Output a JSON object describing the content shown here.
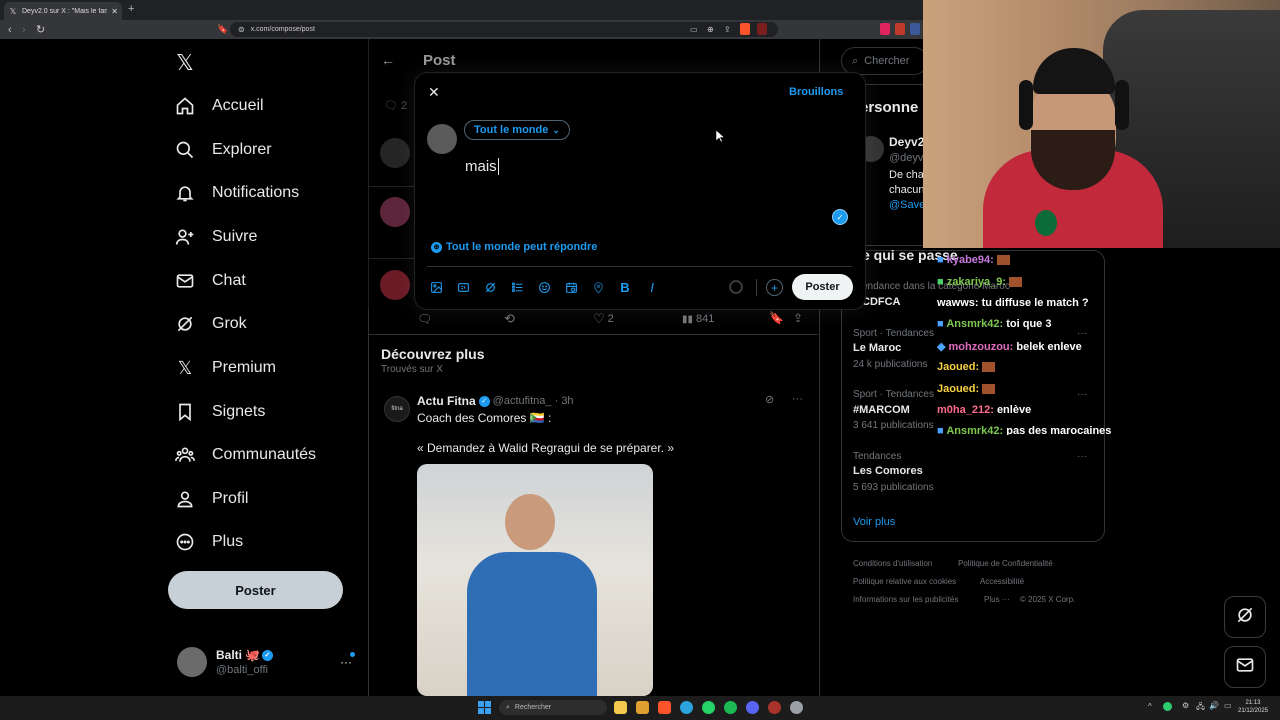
{
  "browser": {
    "tab_title": "Deyv2.0 sur X : \"Mais le fameux...",
    "url": "x.com/compose/post"
  },
  "sidebar": {
    "items": [
      {
        "label": "Accueil",
        "icon": "home-icon"
      },
      {
        "label": "Explorer",
        "icon": "search-icon"
      },
      {
        "label": "Notifications",
        "icon": "bell-icon"
      },
      {
        "label": "Suivre",
        "icon": "follow-icon"
      },
      {
        "label": "Chat",
        "icon": "mail-icon"
      },
      {
        "label": "Grok",
        "icon": "grok-icon"
      },
      {
        "label": "Premium",
        "icon": "x-icon"
      },
      {
        "label": "Signets",
        "icon": "bookmark-icon"
      },
      {
        "label": "Communautés",
        "icon": "communities-icon"
      },
      {
        "label": "Profil",
        "icon": "profile-icon"
      },
      {
        "label": "Plus",
        "icon": "more-circle-icon"
      }
    ],
    "post_button": "Poster",
    "account": {
      "name": "Balti",
      "handle": "@balti_offi"
    }
  },
  "center": {
    "header_title": "Post",
    "reply_count_partial": "2",
    "stats": {
      "likes": "2",
      "views": "841"
    },
    "discover": {
      "title": "Découvrez plus",
      "subtitle": "Trouvés sur X"
    },
    "tweet": {
      "author": "Actu Fitna",
      "handle": "@actufitna_ · 3h",
      "line1": "Coach des Comores 🇰🇲 :",
      "line2": "« Demandez à Walid Regragui de se préparer. »"
    }
  },
  "modal": {
    "drafts": "Brouillons",
    "audience": "Tout le monde",
    "text": "mais",
    "reply_setting": "Tout le monde peut répondre",
    "post_button": "Poster"
  },
  "right": {
    "search_placeholder": "Chercher",
    "suggest_title": "ersonne",
    "suggest_user": {
      "name": "Deyv2",
      "handle": "@deyv",
      "bio1": "De cha",
      "bio2": "chacun",
      "bio3": "@Save"
    },
    "trends_title": "e qui se passe",
    "trends": [
      {
        "context": "endance dans la catégorie Maroc",
        "name": "CDFCA",
        "count": ""
      },
      {
        "context": "Sport · Tendances",
        "name": "Le Maroc",
        "count": "24 k publications"
      },
      {
        "context": "Sport · Tendances",
        "name": "#MARCOM",
        "count": "3 641 publications"
      },
      {
        "context": "Tendances",
        "name": "Les Comores",
        "count": "5 693 publications"
      }
    ],
    "see_more": "Voir plus",
    "footer": [
      "Conditions d'utilisation",
      "Politique de Confidentialité",
      "Politique relative aux cookies",
      "Accessibilité",
      "Informations sur les publicités",
      "Plus ···",
      "© 2025 X Corp."
    ]
  },
  "chat": [
    {
      "user": "kyabe94:",
      "msg": "",
      "color": "#c678dd"
    },
    {
      "user": "zakariya_9:",
      "msg": "",
      "color": "#7ec850"
    },
    {
      "user": "wawws:",
      "msg": "tu diffuse le match ?",
      "color": "#ffffff"
    },
    {
      "user": "Ansmrk42:",
      "msg": "toi que 3",
      "color": "#7ec850"
    },
    {
      "user": "mohzouzou:",
      "msg": "belek enleve",
      "color": "#e06cbf"
    },
    {
      "user": "Jaoued:",
      "msg": "",
      "color": "#f5d142"
    },
    {
      "user": "Jaoued:",
      "msg": "",
      "color": "#f5d142"
    },
    {
      "user": "m0ha_212:",
      "msg": "enlève",
      "color": "#ff6b8a"
    },
    {
      "user": "Ansmrk42:",
      "msg": "pas des marocaines",
      "color": "#7ec850"
    }
  ],
  "taskbar": {
    "search": "Rechercher",
    "time": "21:13",
    "date": "21/12/2025"
  }
}
